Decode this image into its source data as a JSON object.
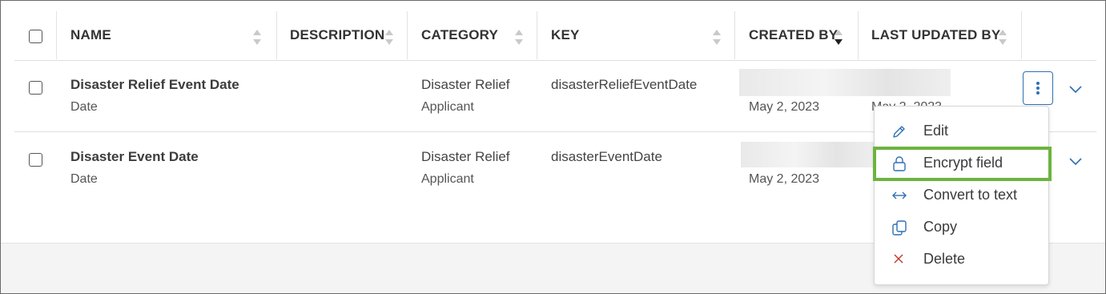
{
  "table": {
    "columns": [
      {
        "label": "NAME"
      },
      {
        "label": "DESCRIPTION"
      },
      {
        "label": "CATEGORY"
      },
      {
        "label": "KEY"
      },
      {
        "label": "CREATED BY"
      },
      {
        "label": "LAST UPDATED BY"
      }
    ],
    "sorted_column": "CREATED BY",
    "sort_direction": "descending",
    "rows": [
      {
        "name": "Disaster Relief Event Date",
        "type": "Date",
        "category": "Disaster Relief",
        "category_sub": "Applicant",
        "key": "disasterReliefEventDate",
        "created_date": "May 2, 2023",
        "updated_date": "May 2, 2023"
      },
      {
        "name": "Disaster Event Date",
        "type": "Date",
        "category": "Disaster Relief",
        "category_sub": "Applicant",
        "key": "disasterEventDate",
        "created_date": "May 2, 2023",
        "updated_date": ""
      }
    ]
  },
  "menu": {
    "items": [
      {
        "label": "Edit",
        "icon": "pencil-icon"
      },
      {
        "label": "Encrypt field",
        "icon": "lock-icon",
        "highlighted": true
      },
      {
        "label": "Convert to text",
        "icon": "arrows-horizontal-icon"
      },
      {
        "label": "Copy",
        "icon": "copy-icon"
      },
      {
        "label": "Delete",
        "icon": "close-icon"
      }
    ]
  },
  "colors": {
    "accent": "#2f6fb3",
    "highlight": "#6db33f",
    "delete": "#c0392b"
  }
}
